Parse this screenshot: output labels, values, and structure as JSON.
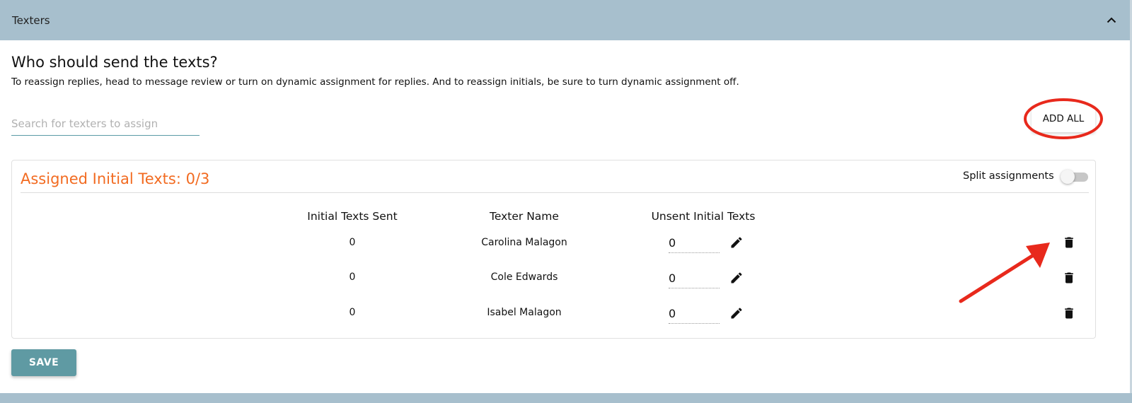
{
  "header": {
    "title": "Texters",
    "collapse_icon": "chevron-up-icon"
  },
  "intro": {
    "heading": "Who should send the texts?",
    "description": "To reassign replies, head to message review or turn on dynamic assignment for replies. And to reassign initials, be sure to turn dynamic assignment off."
  },
  "search": {
    "placeholder": "Search for texters to assign",
    "value": ""
  },
  "add_all_label": "ADD ALL",
  "assignments": {
    "title": "Assigned Initial Texts: 0/3",
    "split_label": "Split assignments",
    "split_enabled": false,
    "columns": [
      "Initial Texts Sent",
      "Texter Name",
      "Unsent Initial Texts"
    ],
    "rows": [
      {
        "sent": "0",
        "name": "Carolina Malagon",
        "unsent": "0"
      },
      {
        "sent": "0",
        "name": "Cole Edwards",
        "unsent": "0"
      },
      {
        "sent": "0",
        "name": "Isabel Malagon",
        "unsent": "0"
      }
    ]
  },
  "save_label": "SAVE",
  "colors": {
    "header": "#a7bfcd",
    "accent_orange": "#f26b21",
    "save_button": "#5f9aa3",
    "annotation_red": "#e8291c"
  },
  "icons": {
    "edit": "pencil-icon",
    "delete": "trash-icon"
  }
}
